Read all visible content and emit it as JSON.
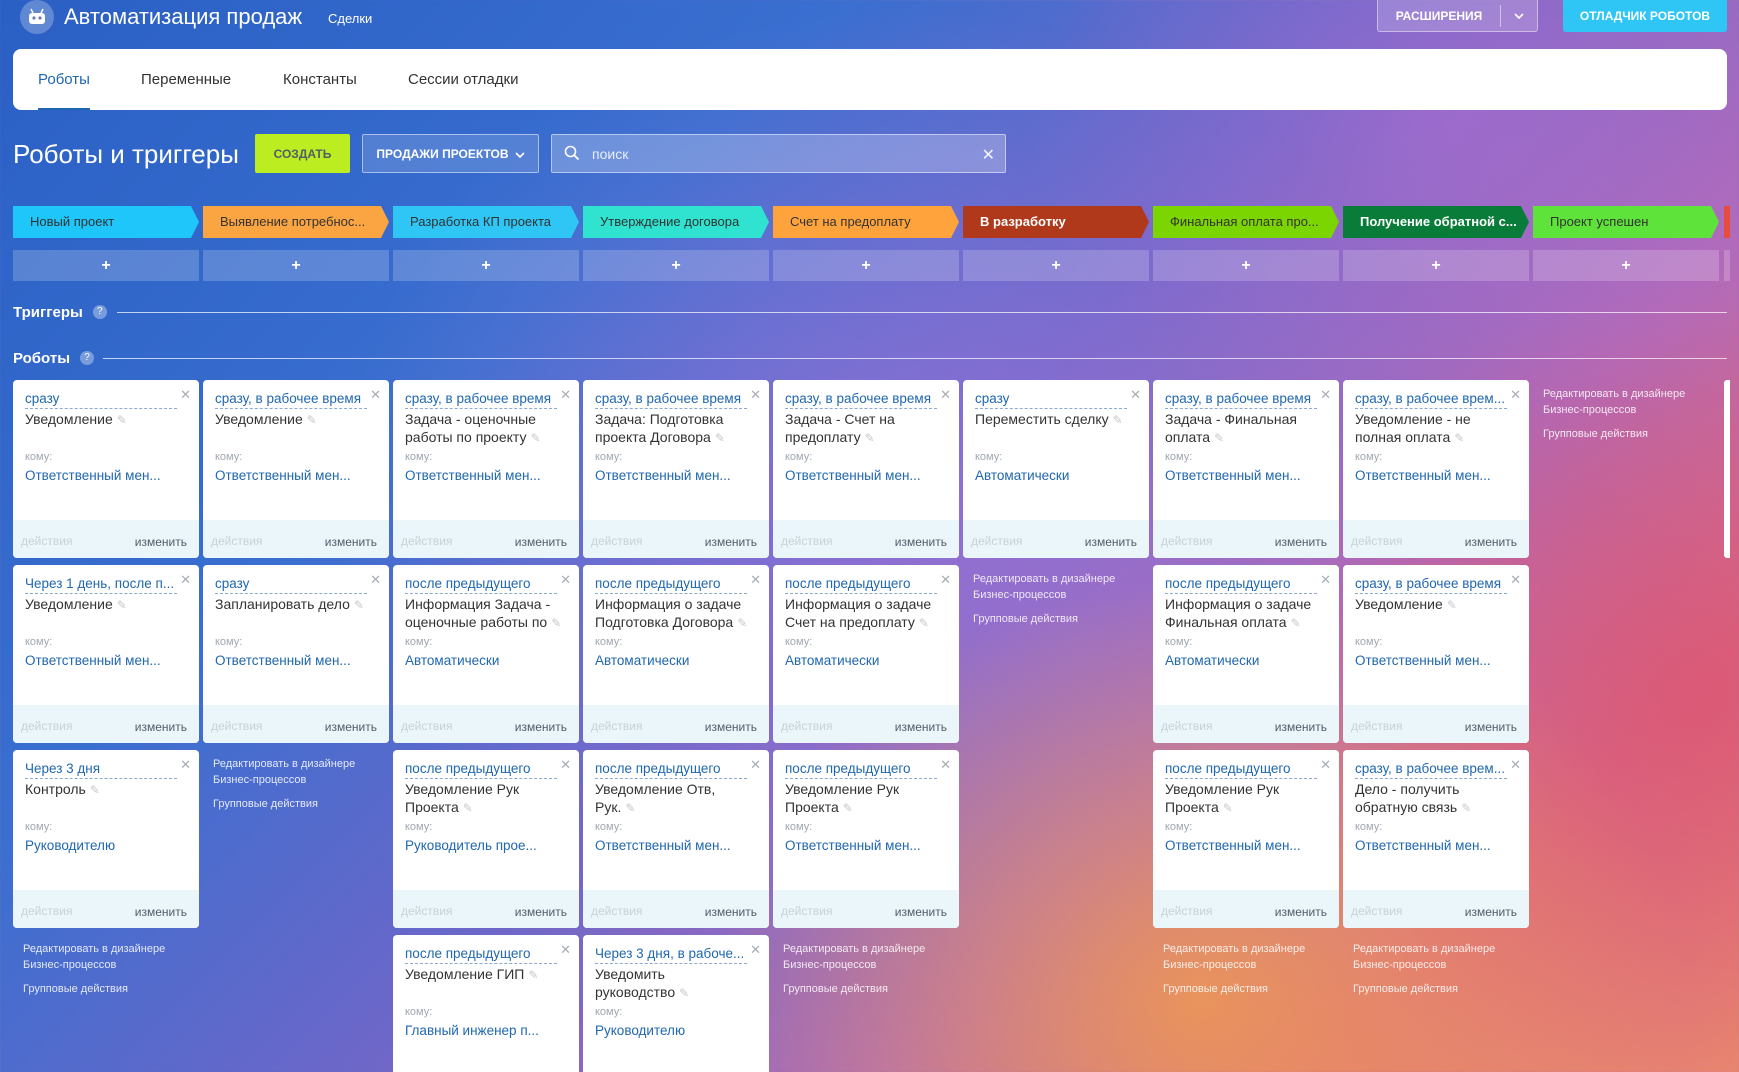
{
  "header": {
    "title": "Автоматизация продаж",
    "subtitle": "Сделки",
    "extensions_label": "РАСШИРЕНИЯ",
    "debugger_label": "ОТЛАДЧИК РОБОТОВ"
  },
  "tabs": [
    {
      "label": "Роботы",
      "active": true
    },
    {
      "label": "Переменные",
      "active": false
    },
    {
      "label": "Константы",
      "active": false
    },
    {
      "label": "Сессии отладки",
      "active": false
    }
  ],
  "toolbar": {
    "page_title": "Роботы и триггеры",
    "create_label": "СОЗДАТЬ",
    "category_label": "ПРОДАЖИ ПРОЕКТОВ",
    "search_placeholder": "поиск"
  },
  "stages": [
    {
      "label": "Новый проект",
      "color": "#1ec6fa"
    },
    {
      "label": "Выявление потребнос...",
      "color": "#fba442"
    },
    {
      "label": "Разработка КП проекта",
      "color": "#2fc6f6"
    },
    {
      "label": "Утверждение договора",
      "color": "#2fe3d0"
    },
    {
      "label": "Счет на предоплату",
      "color": "#ffa43d"
    },
    {
      "label": "В разработку",
      "color": "#b1391b"
    },
    {
      "label": "Финальная оплата про...",
      "color": "#7bd500"
    },
    {
      "label": "Получение обратной с...",
      "color": "#0a7c3a"
    },
    {
      "label": "Проект успешен",
      "color": "#5ee33b"
    }
  ],
  "stage_add_label": "+",
  "sections": {
    "triggers": "Триггеры",
    "robots": "Роботы",
    "help": "?"
  },
  "common": {
    "to_label": "кому:",
    "actions_label": "действия",
    "edit_label": "изменить",
    "bp_link": "Редактировать в дизайнере Бизнес-процессов",
    "group_actions": "Групповые действия"
  },
  "columns": [
    {
      "robots": [
        {
          "delay": "сразу",
          "title": "Уведомление",
          "to": "Ответственный мен..."
        },
        {
          "delay": "Через 1 день, после п...",
          "title": "Уведомление",
          "to": "Ответственный мен..."
        },
        {
          "delay": "Через 3 дня",
          "title": "Контроль",
          "to": "Руководителю"
        }
      ]
    },
    {
      "robots": [
        {
          "delay": "сразу, в рабочее время",
          "title": "Уведомление",
          "to": "Ответственный мен..."
        },
        {
          "delay": "сразу",
          "title": "Запланировать дело",
          "to": "Ответственный мен..."
        }
      ]
    },
    {
      "robots": [
        {
          "delay": "сразу, в рабочее время",
          "title": "Задача - оценочные работы по проекту",
          "to": "Ответственный мен..."
        },
        {
          "delay": "после предыдущего",
          "title": "Информация Задача - оценочные работы по",
          "to": "Автоматически"
        },
        {
          "delay": "после предыдущего",
          "title": "Уведомление Рук Проекта",
          "to": "Руководитель прое..."
        },
        {
          "delay": "после предыдущего",
          "title": "Уведомление ГИП",
          "to": "Главный инженер п..."
        }
      ]
    },
    {
      "robots": [
        {
          "delay": "сразу, в рабочее время",
          "title": "Задача: Подготовка проекта Договора",
          "to": "Ответственный мен..."
        },
        {
          "delay": "после предыдущего",
          "title": "Информация о задаче Подготовка Договора",
          "to": "Автоматически"
        },
        {
          "delay": "после предыдущего",
          "title": "Уведомление Отв, Рук.",
          "to": "Ответственный мен..."
        },
        {
          "delay": "Через 3 дня, в рабоче...",
          "title": "Уведомить руководство",
          "to": "Руководителю"
        }
      ]
    },
    {
      "robots": [
        {
          "delay": "сразу, в рабочее время",
          "title": "Задача - Счет на предоплату",
          "to": "Ответственный мен..."
        },
        {
          "delay": "после предыдущего",
          "title": "Информация о задаче Счет на предоплату",
          "to": "Автоматически"
        },
        {
          "delay": "после предыдущего",
          "title": "Уведомление Рук Проекта",
          "to": "Ответственный мен..."
        }
      ]
    },
    {
      "robots": [
        {
          "delay": "сразу",
          "title": "Переместить сделку",
          "to": "Автоматически"
        }
      ]
    },
    {
      "robots": [
        {
          "delay": "сразу, в рабочее время",
          "title": "Задача - Финальная оплата",
          "to": "Ответственный мен..."
        },
        {
          "delay": "после предыдущего",
          "title": "Информация о задаче Финальная оплата",
          "to": "Автоматически"
        },
        {
          "delay": "после предыдущего",
          "title": "Уведомление Рук Проекта",
          "to": "Ответственный мен..."
        }
      ]
    },
    {
      "robots": [
        {
          "delay": "сразу, в рабочее врем...",
          "title": "Уведомление - не полная оплата",
          "to": "Ответственный мен..."
        },
        {
          "delay": "сразу, в рабочее время",
          "title": "Уведомление",
          "to": "Ответственный мен..."
        },
        {
          "delay": "сразу, в рабочее врем...",
          "title": "Дело - получить обратную связь",
          "to": "Ответственный мен..."
        }
      ]
    },
    {
      "robots": []
    }
  ],
  "colors": {
    "accent": "#2067b0",
    "create": "#bbed21",
    "debugger": "#2fc6f6"
  }
}
